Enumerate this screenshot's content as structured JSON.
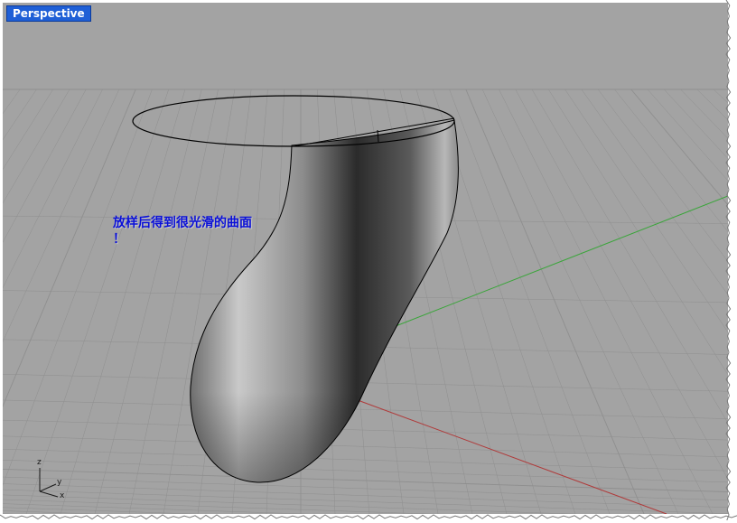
{
  "viewport": {
    "title": "Perspective",
    "tab_color": "#1f5fd6",
    "background": "#a3a3a3",
    "grid_color": "#8f8f8f",
    "x_axis_color": "#b03a3a",
    "y_axis_color": "#3aa53a"
  },
  "annotation": {
    "line1": "放样后得到很光滑的曲面",
    "line2": "！",
    "color": "#0a10d8"
  },
  "axis_indicator": {
    "z_label": "z",
    "y_label": "y",
    "x_label": "x"
  },
  "model": {
    "type": "lofted-surface",
    "profile_curve": "ellipse"
  }
}
